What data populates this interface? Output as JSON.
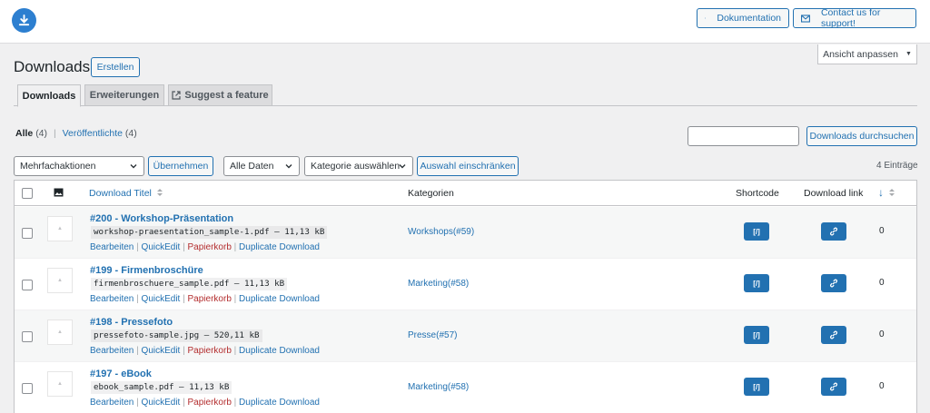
{
  "header": {
    "doc_label": "Dokumentation",
    "contact_label": "Contact us for support!"
  },
  "screen_options": {
    "label": "Ansicht anpassen"
  },
  "page": {
    "title": "Downloads",
    "create_label": "Erstellen"
  },
  "tabs": [
    {
      "label": "Downloads",
      "active": true
    },
    {
      "label": "Erweiterungen",
      "active": false
    },
    {
      "label": "Suggest a feature",
      "active": false,
      "icon": "external-link-icon"
    }
  ],
  "filters": {
    "all_label": "Alle",
    "all_count": "(4)",
    "separator": "|",
    "published_label": "Veröffentlichte",
    "published_count": "(4)"
  },
  "search": {
    "value": "",
    "button_label": "Downloads durchsuchen"
  },
  "bulk": {
    "action_select": "Mehrfachaktionen",
    "apply_label": "Übernehmen",
    "date_select": "Alle Daten",
    "category_select": "Kategorie auswählen",
    "filter_label": "Auswahl einschränken",
    "count": "4 Einträge"
  },
  "columns": {
    "title": "Download Titel",
    "categories": "Kategorien",
    "shortcode": "Shortcode",
    "download_link": "Download link",
    "count_sort": "↓"
  },
  "row_actions": {
    "edit": "Bearbeiten",
    "quick_edit": "QuickEdit",
    "trash": "Papierkorb",
    "duplicate": "Duplicate Download",
    "separator": "|"
  },
  "rows": [
    {
      "title": "#200 - Workshop-Präsentation",
      "file": "workshop-praesentation_sample-1.pdf – 11,13 kB",
      "category": "Workshops(#59)",
      "count": "0"
    },
    {
      "title": "#199 - Firmenbroschüre",
      "file": "firmenbroschuere_sample.pdf – 11,13 kB",
      "category": "Marketing(#58)",
      "count": "0"
    },
    {
      "title": "#198 - Pressefoto",
      "file": "pressefoto-sample.jpg – 520,11 kB",
      "category": "Presse(#57)",
      "count": "0"
    },
    {
      "title": "#197 - eBook",
      "file": "ebook_sample.pdf – 11,13 kB",
      "category": "Marketing(#58)",
      "count": "0"
    }
  ],
  "colors": {
    "accent": "#2271b1",
    "trash": "#b32d2e",
    "logo": "#2d7fd0"
  }
}
